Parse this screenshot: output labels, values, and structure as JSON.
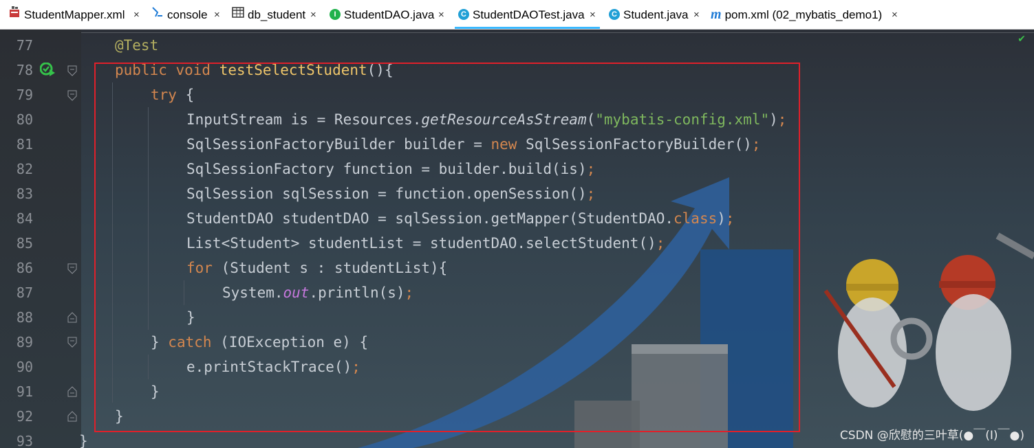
{
  "tabs": [
    {
      "label": "StudentMapper.xml",
      "icon": "xml-file-icon",
      "active": false
    },
    {
      "label": "console",
      "icon": "console-icon",
      "active": false
    },
    {
      "label": "db_student",
      "icon": "table-icon",
      "active": false
    },
    {
      "label": "StudentDAO.java",
      "icon": "interface-icon",
      "active": false
    },
    {
      "label": "StudentDAOTest.java",
      "icon": "class-icon",
      "active": true
    },
    {
      "label": "Student.java",
      "icon": "class-icon",
      "active": false
    },
    {
      "label": "pom.xml (02_mybatis_demo1)",
      "icon": "maven-icon",
      "active": false
    }
  ],
  "tab_close_glyph": "×",
  "line_numbers": [
    "77",
    "78",
    "79",
    "80",
    "81",
    "82",
    "83",
    "84",
    "85",
    "86",
    "87",
    "88",
    "89",
    "90",
    "91",
    "92",
    "93"
  ],
  "code": {
    "l77": {
      "ann": "@Test"
    },
    "l78": {
      "kw": "public void ",
      "fn": "testSelectStudent",
      "rest": "(){"
    },
    "l79": {
      "kw": "try",
      "rest": " {"
    },
    "l80": {
      "a": "InputStream is = Resources.",
      "method": "getResourceAsStream",
      "b": "(",
      "str": "\"mybatis-config.xml\"",
      "c": ")",
      "semi": ";"
    },
    "l81": {
      "a": "SqlSessionFactoryBuilder builder = ",
      "kw": "new",
      "b": " SqlSessionFactoryBuilder()",
      "semi": ";"
    },
    "l82": {
      "a": "SqlSessionFactory function = builder.build(is)",
      "semi": ";"
    },
    "l83": {
      "a": "SqlSession sqlSession = function.openSession()",
      "semi": ";"
    },
    "l84": {
      "a": "StudentDAO studentDAO = sqlSession.getMapper(StudentDAO.",
      "kw": "class",
      "b": ")",
      "semi": ";"
    },
    "l85": {
      "a": "List<Student> studentList = studentDAO.selectStudent()",
      "semi": ";"
    },
    "l86": {
      "kw": "for",
      "rest": " (Student s : studentList){"
    },
    "l87": {
      "a": "System.",
      "field": "out",
      "b": ".println(s)",
      "semi": ";"
    },
    "l88": {
      "rest": "}"
    },
    "l89": {
      "a": "} ",
      "kw": "catch",
      "b": " (IOException e) {"
    },
    "l90": {
      "a": "e.printStackTrace()",
      "semi": ";"
    },
    "l91": {
      "rest": "}"
    },
    "l92": {
      "rest": "}"
    },
    "l93": {
      "rest": "}"
    }
  },
  "watermark": "CSDN @欣慰的三叶草(●￣(I)￣●)",
  "colors": {
    "highlight_box": "#e0202a",
    "active_tab_underline": "#39b8ff",
    "keyword": "#d4874f",
    "string": "#7fb85e",
    "annotation": "#b3ae60",
    "function_name": "#f0c66a"
  }
}
